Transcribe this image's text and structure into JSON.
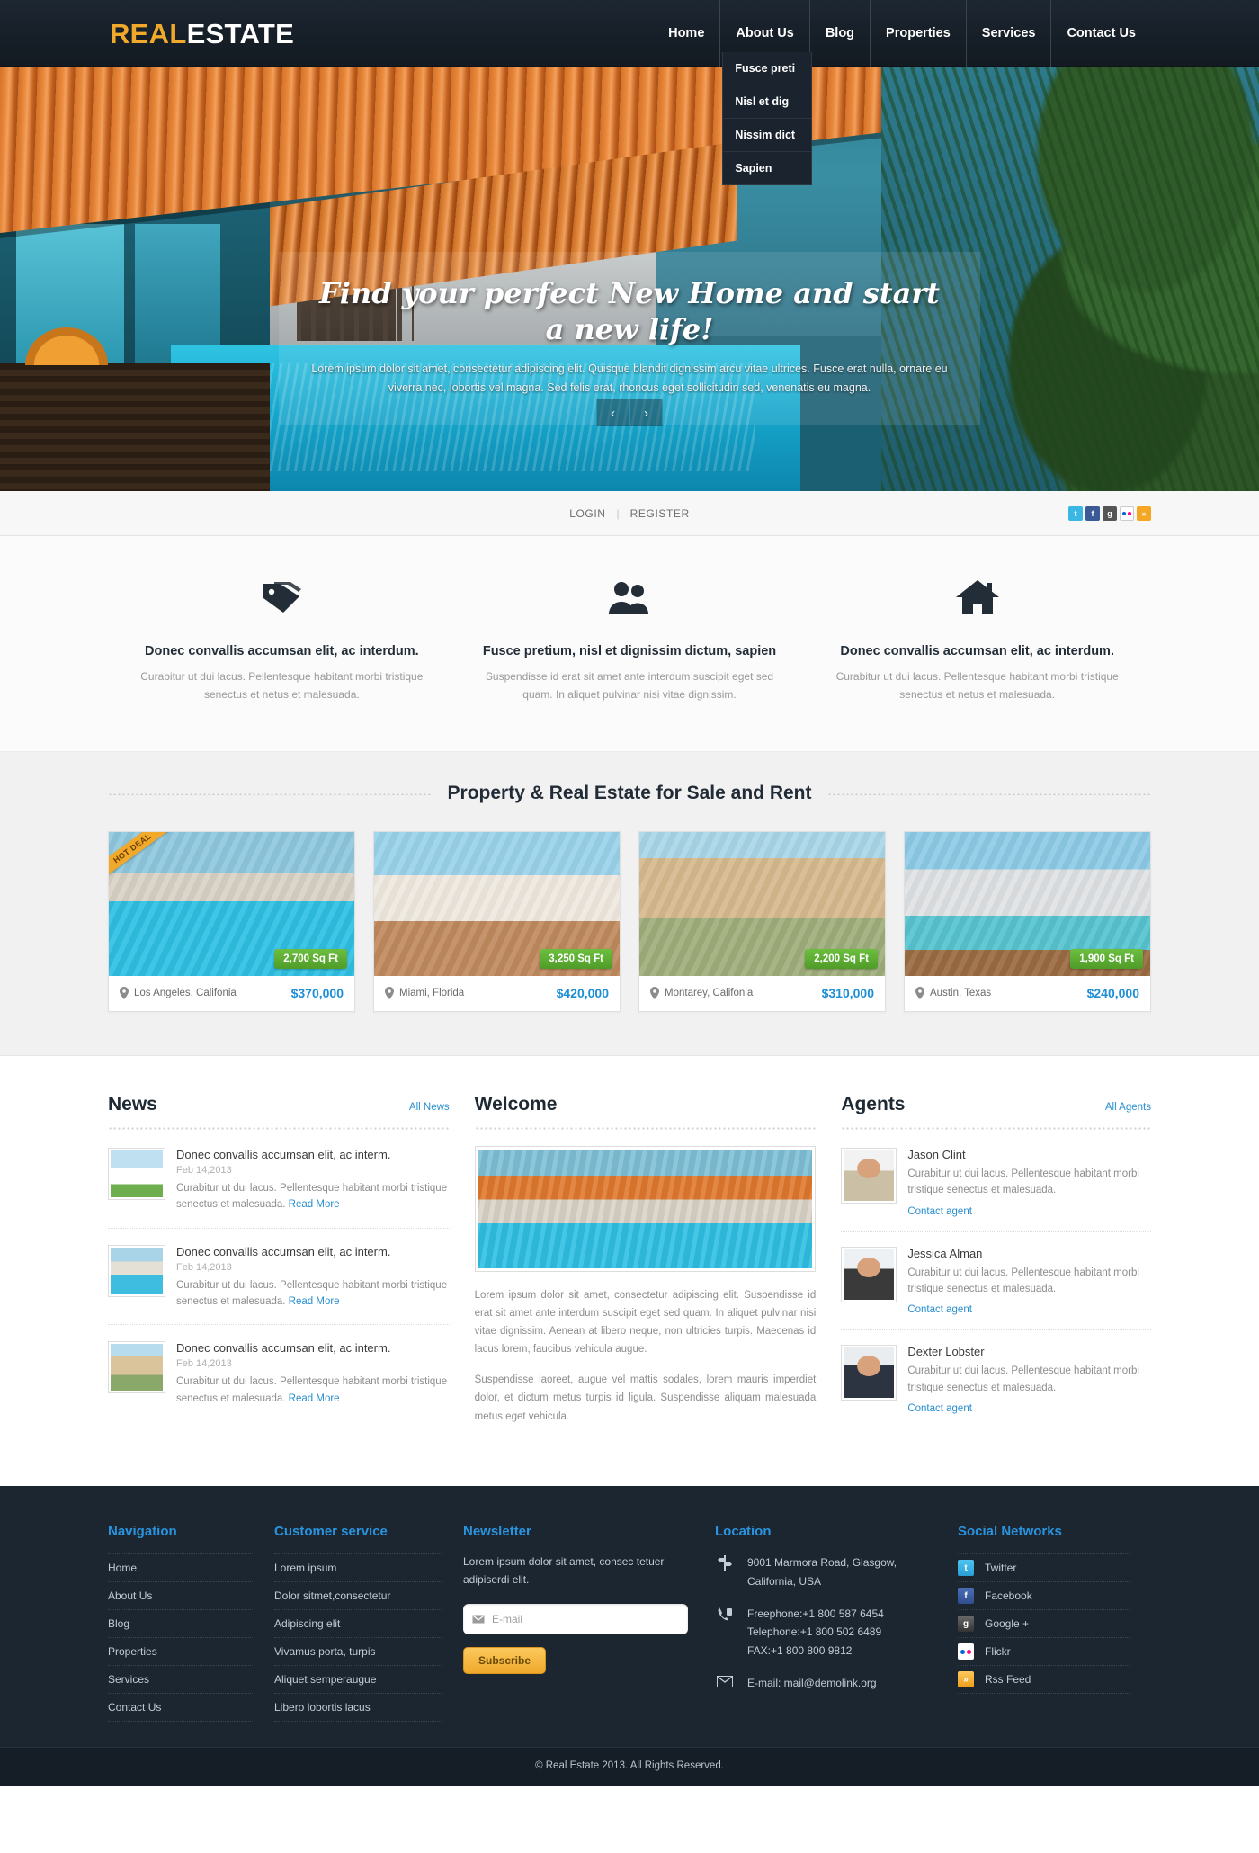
{
  "header": {
    "logo_word1": "REAL",
    "logo_word2": "ESTATE",
    "nav": [
      {
        "label": "Home"
      },
      {
        "label": "About Us"
      },
      {
        "label": "Blog"
      },
      {
        "label": "Properties"
      },
      {
        "label": "Services"
      },
      {
        "label": "Contact Us"
      }
    ],
    "submenu": [
      {
        "label": "Fusce preti"
      },
      {
        "label": "Nisl et dig"
      },
      {
        "label": "Nissim dict"
      },
      {
        "label": "Sapien"
      }
    ]
  },
  "hero": {
    "title": "Find your perfect New Home and start a new life!",
    "text": "Lorem ipsum dolor sit amet, consectetur adipiscing elit. Quisque blandit dignissim arcu vitae ultrices. Fusce erat nulla, ornare eu viverra nec, lobortis vel magna. Sed felis erat, rhoncus eget sollicitudin sed, venenatis eu magna.",
    "prev_arrow": "‹",
    "next_arrow": "›"
  },
  "loginbar": {
    "login": "LOGIN",
    "separator": "|",
    "register": "REGISTER",
    "social": [
      {
        "name": "twitter-icon",
        "glyph": "t"
      },
      {
        "name": "facebook-icon",
        "glyph": "f"
      },
      {
        "name": "google-plus-icon",
        "glyph": "g"
      },
      {
        "name": "flickr-icon",
        "glyph": ""
      },
      {
        "name": "rss-icon",
        "glyph": "»"
      }
    ]
  },
  "features": [
    {
      "icon": "price-tags-icon",
      "title": "Donec convallis accumsan elit, ac interdum.",
      "text": "Curabitur ut dui lacus. Pellentesque habitant morbi tristique senectus et netus et malesuada."
    },
    {
      "icon": "people-icon",
      "title": "Fusce pretium, nisl et dignissim dictum, sapien",
      "text": "Suspendisse id erat sit amet ante interdum suscipit eget sed quam. In aliquet pulvinar nisi vitae dignissim."
    },
    {
      "icon": "house-icon",
      "title": "Donec convallis accumsan elit, ac interdum.",
      "text": "Curabitur ut dui lacus. Pellentesque habitant morbi tristique senectus et netus et malesuada."
    }
  ],
  "properties": {
    "section_title": "Property & Real Estate for Sale and Rent",
    "hot_deal_badge": "HOT DEAL",
    "items": [
      {
        "location": "Los Angeles, Califonia",
        "price": "$370,000",
        "sqft": "2,700 Sq Ft",
        "hot_deal": true
      },
      {
        "location": "Miami, Florida",
        "price": "$420,000",
        "sqft": "3,250 Sq Ft",
        "hot_deal": false
      },
      {
        "location": "Montarey, Califonia",
        "price": "$310,000",
        "sqft": "2,200 Sq Ft",
        "hot_deal": false
      },
      {
        "location": "Austin, Texas",
        "price": "$240,000",
        "sqft": "1,900 Sq Ft",
        "hot_deal": false
      }
    ]
  },
  "news": {
    "title": "News",
    "all_link": "All News",
    "read_more": "Read More",
    "items": [
      {
        "headline": "Donec convallis accumsan elit, ac interm.",
        "date": "Feb 14,2013",
        "text": "Curabitur ut dui lacus. Pellentesque habitant morbi tristique senectus et malesuada."
      },
      {
        "headline": "Donec convallis accumsan elit, ac interm.",
        "date": "Feb 14,2013",
        "text": "Curabitur ut dui lacus. Pellentesque habitant morbi tristique senectus et malesuada."
      },
      {
        "headline": "Donec convallis accumsan elit, ac interm.",
        "date": "Feb 14,2013",
        "text": "Curabitur ut dui lacus. Pellentesque habitant morbi tristique senectus et malesuada."
      }
    ]
  },
  "welcome": {
    "title": "Welcome",
    "paragraph1": "Lorem ipsum dolor sit amet, consectetur adipiscing elit. Suspendisse id erat sit amet ante interdum suscipit eget sed quam. In aliquet pulvinar nisi vitae dignissim. Aenean at libero neque, non ultricies turpis. Maecenas id lacus lorem, faucibus vehicula augue.",
    "paragraph2": "Suspendisse laoreet, augue vel mattis sodales, lorem mauris imperdiet dolor, et dictum metus turpis id ligula. Suspendisse aliquam malesuada metus eget vehicula."
  },
  "agents": {
    "title": "Agents",
    "all_link": "All Agents",
    "contact_label": "Contact agent",
    "items": [
      {
        "name": "Jason Clint",
        "text": "Curabitur ut dui lacus. Pellentesque habitant morbi tristique senectus et malesuada."
      },
      {
        "name": "Jessica Alman",
        "text": "Curabitur ut dui lacus. Pellentesque habitant morbi tristique senectus et malesuada."
      },
      {
        "name": "Dexter Lobster",
        "text": "Curabitur ut dui lacus. Pellentesque habitant morbi tristique senectus et malesuada."
      }
    ]
  },
  "footer": {
    "navigation": {
      "title": "Navigation",
      "items": [
        {
          "label": "Home"
        },
        {
          "label": "About Us"
        },
        {
          "label": "Blog"
        },
        {
          "label": "Properties"
        },
        {
          "label": "Services"
        },
        {
          "label": "Contact Us"
        }
      ]
    },
    "customer_service": {
      "title": "Customer service",
      "items": [
        {
          "label": "Lorem ipsum"
        },
        {
          "label": "Dolor sitmet,consectetur"
        },
        {
          "label": "Adipiscing elit"
        },
        {
          "label": "Vivamus porta, turpis"
        },
        {
          "label": "Aliquet semperaugue"
        },
        {
          "label": "Libero lobortis lacus"
        }
      ]
    },
    "newsletter": {
      "title": "Newsletter",
      "text": "Lorem ipsum dolor sit amet, consec tetuer adipiserdi elit.",
      "email_placeholder": "E-mail",
      "subscribe_label": "Subscribe"
    },
    "location": {
      "title": "Location",
      "address": "9001 Marmora Road, Glasgow, California, USA",
      "freephone": "Freephone:+1 800 587 6454",
      "telephone": "Telephone:+1 800 502 6489",
      "fax": "FAX:+1 800 800 9812",
      "email": "E-mail: mail@demolink.org"
    },
    "social": {
      "title": "Social Networks",
      "items": [
        {
          "label": "Twitter",
          "icon": "twitter-icon"
        },
        {
          "label": "Facebook",
          "icon": "facebook-icon"
        },
        {
          "label": "Google +",
          "icon": "google-plus-icon"
        },
        {
          "label": "Flickr",
          "icon": "flickr-icon"
        },
        {
          "label": "Rss Feed",
          "icon": "rss-icon"
        }
      ]
    },
    "copyright": "© Real Estate 2013. All Rights Reserved."
  },
  "colors": {
    "accent_orange": "#f0a92b",
    "accent_blue": "#2a8fd0",
    "dark_navy": "#1c2631",
    "green_badge": "#4f9c28"
  }
}
